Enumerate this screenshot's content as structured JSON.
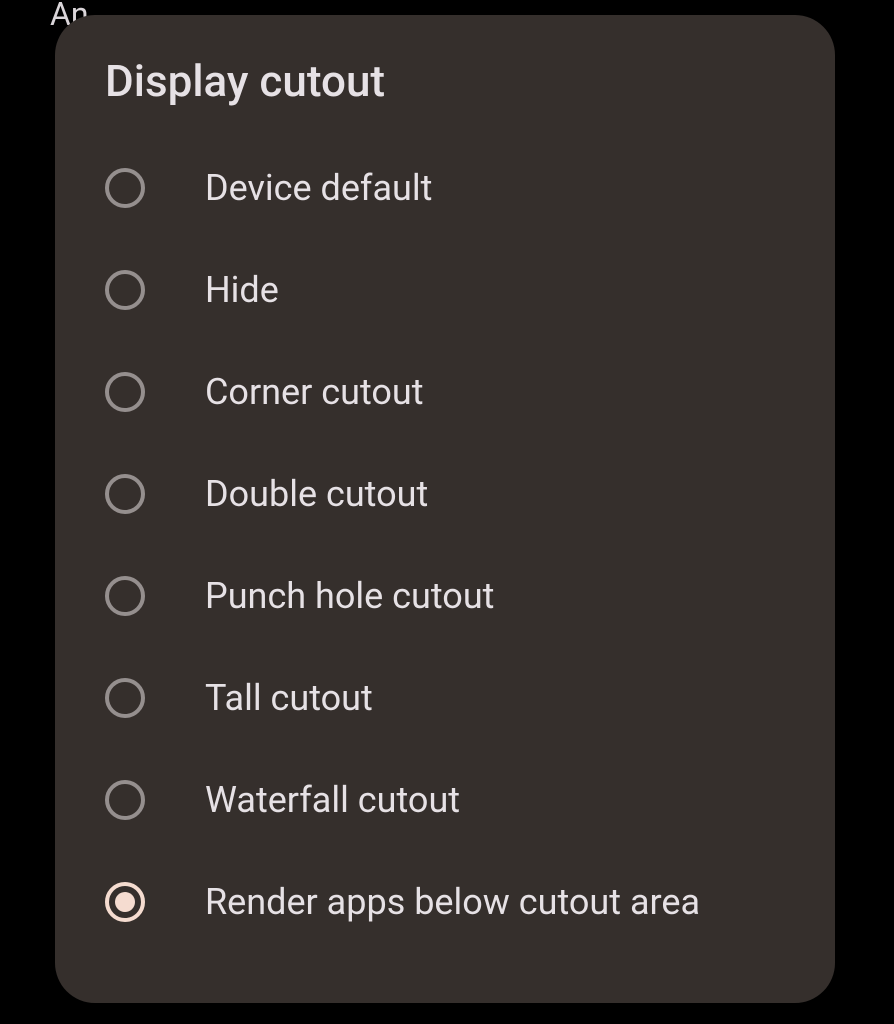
{
  "background": {
    "topText": "An"
  },
  "dialog": {
    "title": "Display cutout",
    "options": [
      {
        "label": "Device default",
        "selected": false
      },
      {
        "label": "Hide",
        "selected": false
      },
      {
        "label": "Corner cutout",
        "selected": false
      },
      {
        "label": "Double cutout",
        "selected": false
      },
      {
        "label": "Punch hole cutout",
        "selected": false
      },
      {
        "label": "Tall cutout",
        "selected": false
      },
      {
        "label": "Waterfall cutout",
        "selected": false
      },
      {
        "label": "Render apps below cutout area",
        "selected": true
      }
    ]
  }
}
